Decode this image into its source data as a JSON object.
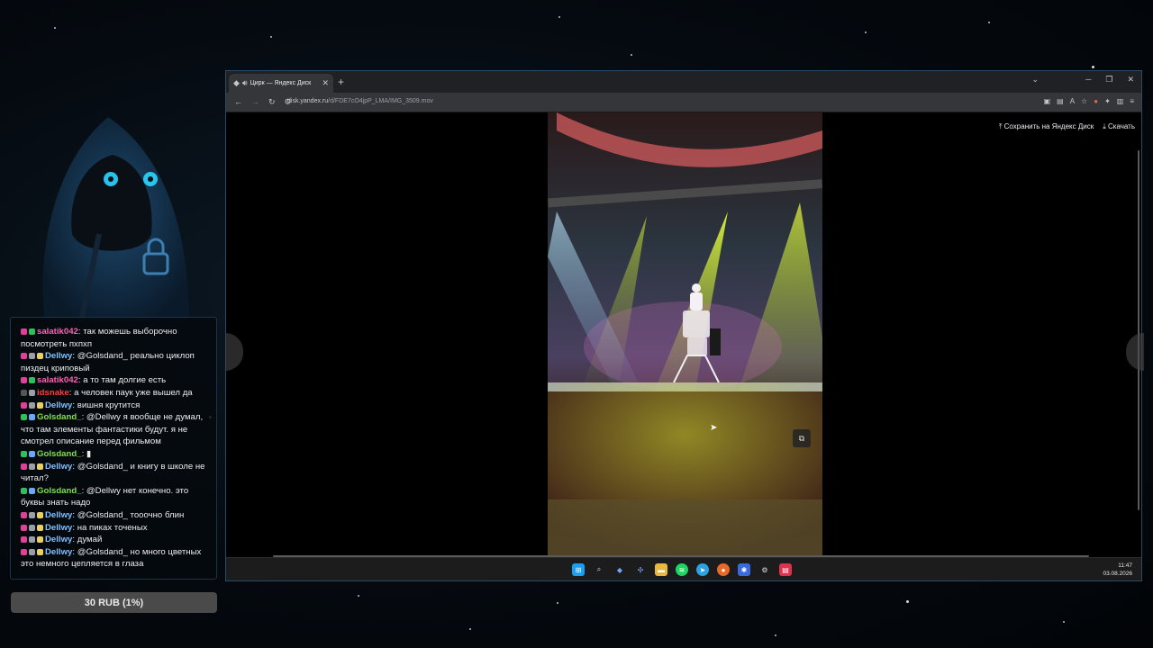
{
  "chat": {
    "messages": [
      {
        "user": "salatik042",
        "color": "#ff5fb4",
        "badges": [
          "#e0409a",
          "#2fbf5d"
        ],
        "text": "так можешь выборочно посмотреть пхпхп"
      },
      {
        "user": "Dellwy",
        "color": "#7ec0ff",
        "badges": [
          "#e0409a",
          "#9aa0a6",
          "#e9d060"
        ],
        "text": "@Golsdand_ реально циклоп пиздец криповый"
      },
      {
        "user": "salatik042",
        "color": "#ff5fb4",
        "badges": [
          "#e0409a",
          "#2fbf5d"
        ],
        "text": "а то там долгие есть"
      },
      {
        "user": "idsnake",
        "color": "#ff3b3b",
        "badges": [
          "#555555",
          "#9aa0a6"
        ],
        "text": "а человек паук уже вышел да"
      },
      {
        "user": "Dellwy",
        "color": "#7ec0ff",
        "badges": [
          "#e0409a",
          "#9aa0a6",
          "#e9d060"
        ],
        "text": "вишня крутится"
      },
      {
        "user": "Golsdand_",
        "color": "#7ee04a",
        "badges": [
          "#2fbf5d",
          "#6aa7ff"
        ],
        "text": "@Dellwy я вообще не думал, что там элементы фантастики будут. я не смотрел описание перед фильмом"
      },
      {
        "user": "Golsdand_",
        "color": "#7ee04a",
        "badges": [
          "#2fbf5d",
          "#6aa7ff"
        ],
        "text": "▮"
      },
      {
        "user": "Dellwy",
        "color": "#7ec0ff",
        "badges": [
          "#e0409a",
          "#9aa0a6",
          "#e9d060"
        ],
        "text": "@Golsdand_ и книгу в школе не читал?"
      },
      {
        "user": "Golsdand_",
        "color": "#7ee04a",
        "badges": [
          "#2fbf5d",
          "#6aa7ff"
        ],
        "text": "@Dellwy нет конечно. это буквы знать надо"
      },
      {
        "user": "Dellwy",
        "color": "#7ec0ff",
        "badges": [
          "#e0409a",
          "#9aa0a6",
          "#e9d060"
        ],
        "text": "@Golsdand_ тооочно блин"
      },
      {
        "user": "Dellwy",
        "color": "#7ec0ff",
        "badges": [
          "#e0409a",
          "#9aa0a6",
          "#e9d060"
        ],
        "text": "на пиках точеных"
      },
      {
        "user": "Dellwy",
        "color": "#7ec0ff",
        "badges": [
          "#e0409a",
          "#9aa0a6",
          "#e9d060"
        ],
        "text": "думай"
      },
      {
        "user": "Dellwy",
        "color": "#7ec0ff",
        "badges": [
          "#e0409a",
          "#9aa0a6",
          "#e9d060"
        ],
        "text": "@Golsdand_ но много цветных это немного цепляется в глаза"
      }
    ]
  },
  "donation_bar": {
    "label": "30 RUB (1%)"
  },
  "browser": {
    "tab_title": "Цирк — Яндекс Диск",
    "url_host": "disk.yandex.ru",
    "url_path": "/d/FDE7cO4jpP_LMA/IMG_3509.mov",
    "save_to_disk_label": "Сохранить на Яндекс Диск",
    "download_label": "Скачать"
  },
  "taskbar": {
    "time": "11:47",
    "date": "03.08.2026"
  },
  "colors": {
    "accent_border": "#2b4a63",
    "chat_border": "#1f3347"
  }
}
